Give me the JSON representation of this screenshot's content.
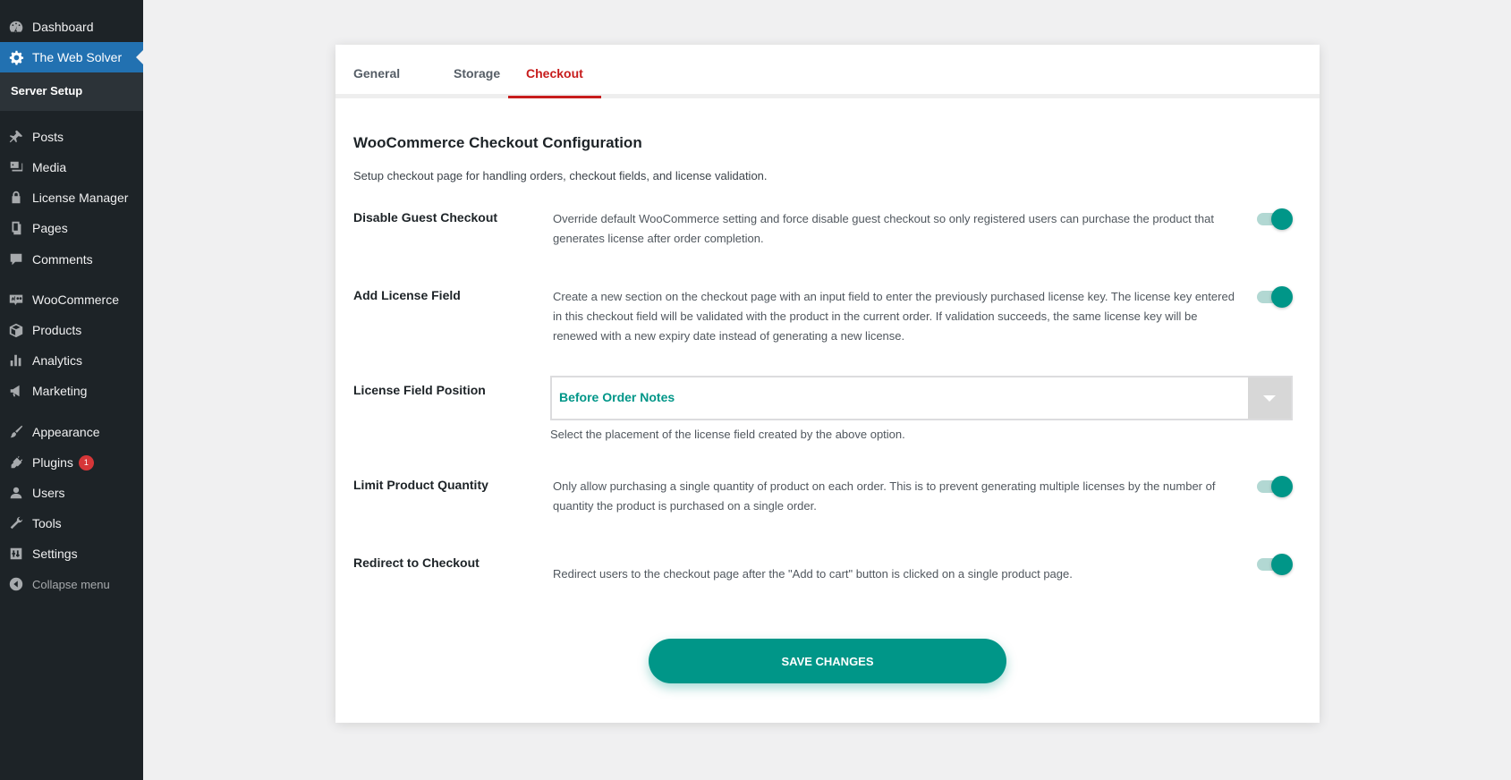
{
  "sidebar": {
    "dashboard": "Dashboard",
    "web_solver": "The Web Solver",
    "server_setup": "Server Setup",
    "posts": "Posts",
    "media": "Media",
    "license_manager": "License Manager",
    "pages": "Pages",
    "comments": "Comments",
    "woocommerce": "WooCommerce",
    "products": "Products",
    "analytics": "Analytics",
    "marketing": "Marketing",
    "appearance": "Appearance",
    "plugins": "Plugins",
    "plugins_badge": "1",
    "users": "Users",
    "tools": "Tools",
    "settings": "Settings",
    "collapse": "Collapse menu"
  },
  "tabs": {
    "general": "General",
    "storage": "Storage",
    "checkout": "Checkout"
  },
  "section": {
    "title": "WooCommerce Checkout Configuration",
    "description": "Setup checkout page for handling orders, checkout fields, and license validation."
  },
  "settings": {
    "guest_checkout": {
      "label": "Disable Guest Checkout",
      "description": "Override default WooCommerce setting and force disable guest checkout so only registered users can purchase the product that generates license after order completion.",
      "enabled": true
    },
    "license_field": {
      "label": "Add License Field",
      "description": "Create a new section on the checkout page with an input field to enter the previously purchased license key. The license key entered in this checkout field will be validated with the product in the current order. If validation succeeds, the same license key will be renewed with a new expiry date instead of generating a new license.",
      "enabled": true
    },
    "field_position": {
      "label": "License Field Position",
      "selected": "Before Order Notes",
      "help": "Select the placement of the license field created by the above option."
    },
    "limit_quantity": {
      "label": "Limit Product Quantity",
      "description": "Only allow purchasing a single quantity of product on each order. This is to prevent generating multiple licenses by the number of quantity the product is purchased on a single order.",
      "enabled": true
    },
    "redirect_checkout": {
      "label": "Redirect to Checkout",
      "description": "Redirect users to the checkout page after the \"Add to cart\" button is clicked on a single product page.",
      "enabled": true
    }
  },
  "save_label": "SAVE CHANGES",
  "colors": {
    "accent": "#009688",
    "active_tab": "#c71c1c",
    "sidebar_bg": "#1d2327",
    "sidebar_active": "#2271b1"
  }
}
